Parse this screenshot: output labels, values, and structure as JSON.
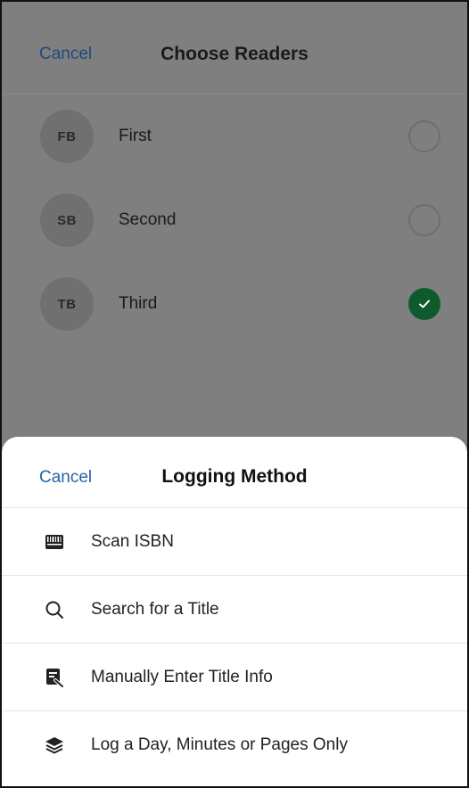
{
  "background": {
    "cancel_label": "Cancel",
    "title": "Choose Readers",
    "readers": [
      {
        "initials": "FB",
        "name": "First",
        "selected": false
      },
      {
        "initials": "SB",
        "name": "Second",
        "selected": false
      },
      {
        "initials": "TB",
        "name": "Third",
        "selected": true
      }
    ]
  },
  "sheet": {
    "cancel_label": "Cancel",
    "title": "Logging Method",
    "options": [
      {
        "icon": "barcode-icon",
        "label": "Scan ISBN"
      },
      {
        "icon": "search-icon",
        "label": "Search for a Title"
      },
      {
        "icon": "edit-document-icon",
        "label": "Manually Enter Title Info"
      },
      {
        "icon": "layers-icon",
        "label": "Log a Day, Minutes or Pages Only"
      }
    ]
  },
  "colors": {
    "accent": "#2763a8",
    "check_green": "#0f5a2c",
    "overlay": "#7f7f7f"
  }
}
